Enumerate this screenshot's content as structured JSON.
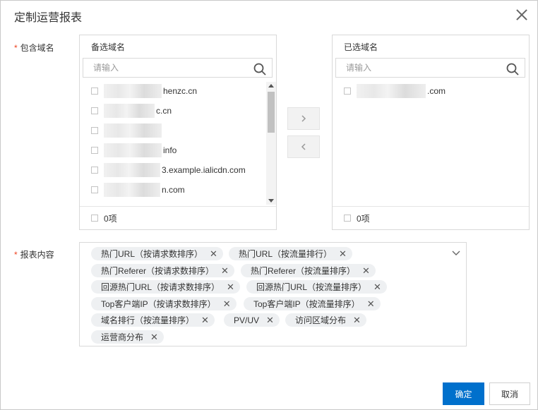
{
  "dialog": {
    "title": "定制运营报表",
    "domains_label": "包含域名",
    "content_label": "报表内容",
    "required_mark": "*"
  },
  "available": {
    "header": "备选域名",
    "search_placeholder": "请输入",
    "items": [
      {
        "text": "henzc.cn",
        "mask_width": 82
      },
      {
        "text": "c.cn",
        "mask_width": 72
      },
      {
        "text": "",
        "mask_width": 82
      },
      {
        "text": "info",
        "mask_width": 82
      },
      {
        "text": "3.example.ialicdn.com",
        "mask_width": 80
      },
      {
        "text": "n.com",
        "mask_width": 80
      }
    ],
    "footer_count": "0项"
  },
  "selected": {
    "header": "已选域名",
    "search_placeholder": "请输入",
    "items": [
      {
        "text": ".com",
        "mask_width": 98
      }
    ],
    "footer_count": "0项"
  },
  "report_tags": [
    "热门URL（按请求数排序）",
    "热门URL（按流量排行）",
    "热门Referer（按请求数排序）",
    "热门Referer（按流量排序）",
    "回源热门URL（按请求数排序）",
    "回源热门URL（按流量排序）",
    "Top客户端IP（按请求数排序）",
    "Top客户端IP（按流量排序）",
    "域名排行（按流量排序）",
    "PV/UV",
    "访问区域分布",
    "运营商分布"
  ],
  "buttons": {
    "confirm": "确定",
    "cancel": "取消"
  },
  "colors": {
    "primary": "#0070cc",
    "required": "#ee4422",
    "tag_bg": "#eef0f2"
  }
}
